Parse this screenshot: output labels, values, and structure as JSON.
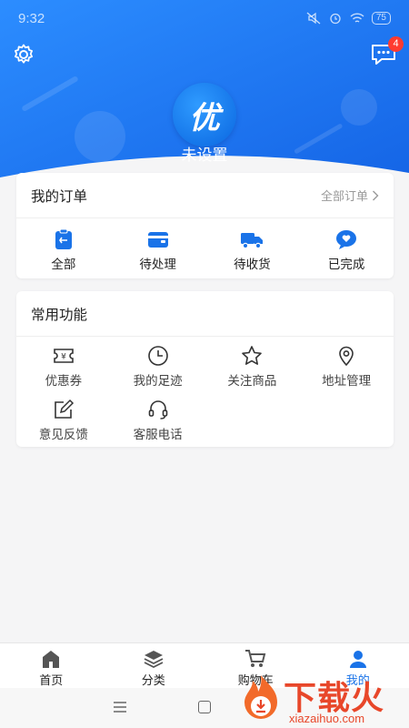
{
  "status_bar": {
    "time": "9:32",
    "battery": "75"
  },
  "header": {
    "avatar_text": "优",
    "username": "未设置",
    "message_badge": "4"
  },
  "orders": {
    "title": "我的订单",
    "all_link": "全部订单",
    "items": [
      {
        "label": "全部",
        "icon": "clipboard-icon"
      },
      {
        "label": "待处理",
        "icon": "wallet-icon"
      },
      {
        "label": "待收货",
        "icon": "truck-icon"
      },
      {
        "label": "已完成",
        "icon": "heart-chat-icon"
      }
    ]
  },
  "tools": {
    "title": "常用功能",
    "items": [
      {
        "label": "优惠券",
        "icon": "coupon-icon"
      },
      {
        "label": "我的足迹",
        "icon": "clock-icon"
      },
      {
        "label": "关注商品",
        "icon": "star-icon"
      },
      {
        "label": "地址管理",
        "icon": "location-icon"
      },
      {
        "label": "意见反馈",
        "icon": "edit-icon"
      },
      {
        "label": "客服电话",
        "icon": "headset-icon"
      }
    ]
  },
  "tabbar": {
    "items": [
      {
        "label": "首页",
        "icon": "home-icon"
      },
      {
        "label": "分类",
        "icon": "layers-icon"
      },
      {
        "label": "购物车",
        "icon": "cart-icon"
      },
      {
        "label": "我的",
        "icon": "user-icon"
      }
    ],
    "active": "我的"
  },
  "watermark": {
    "text": "下载火",
    "sub": "xiazaihuo.com"
  },
  "colors": {
    "accent": "#1a73e8",
    "header_blue": "#1c7cf4",
    "badge": "#ff3b30"
  }
}
